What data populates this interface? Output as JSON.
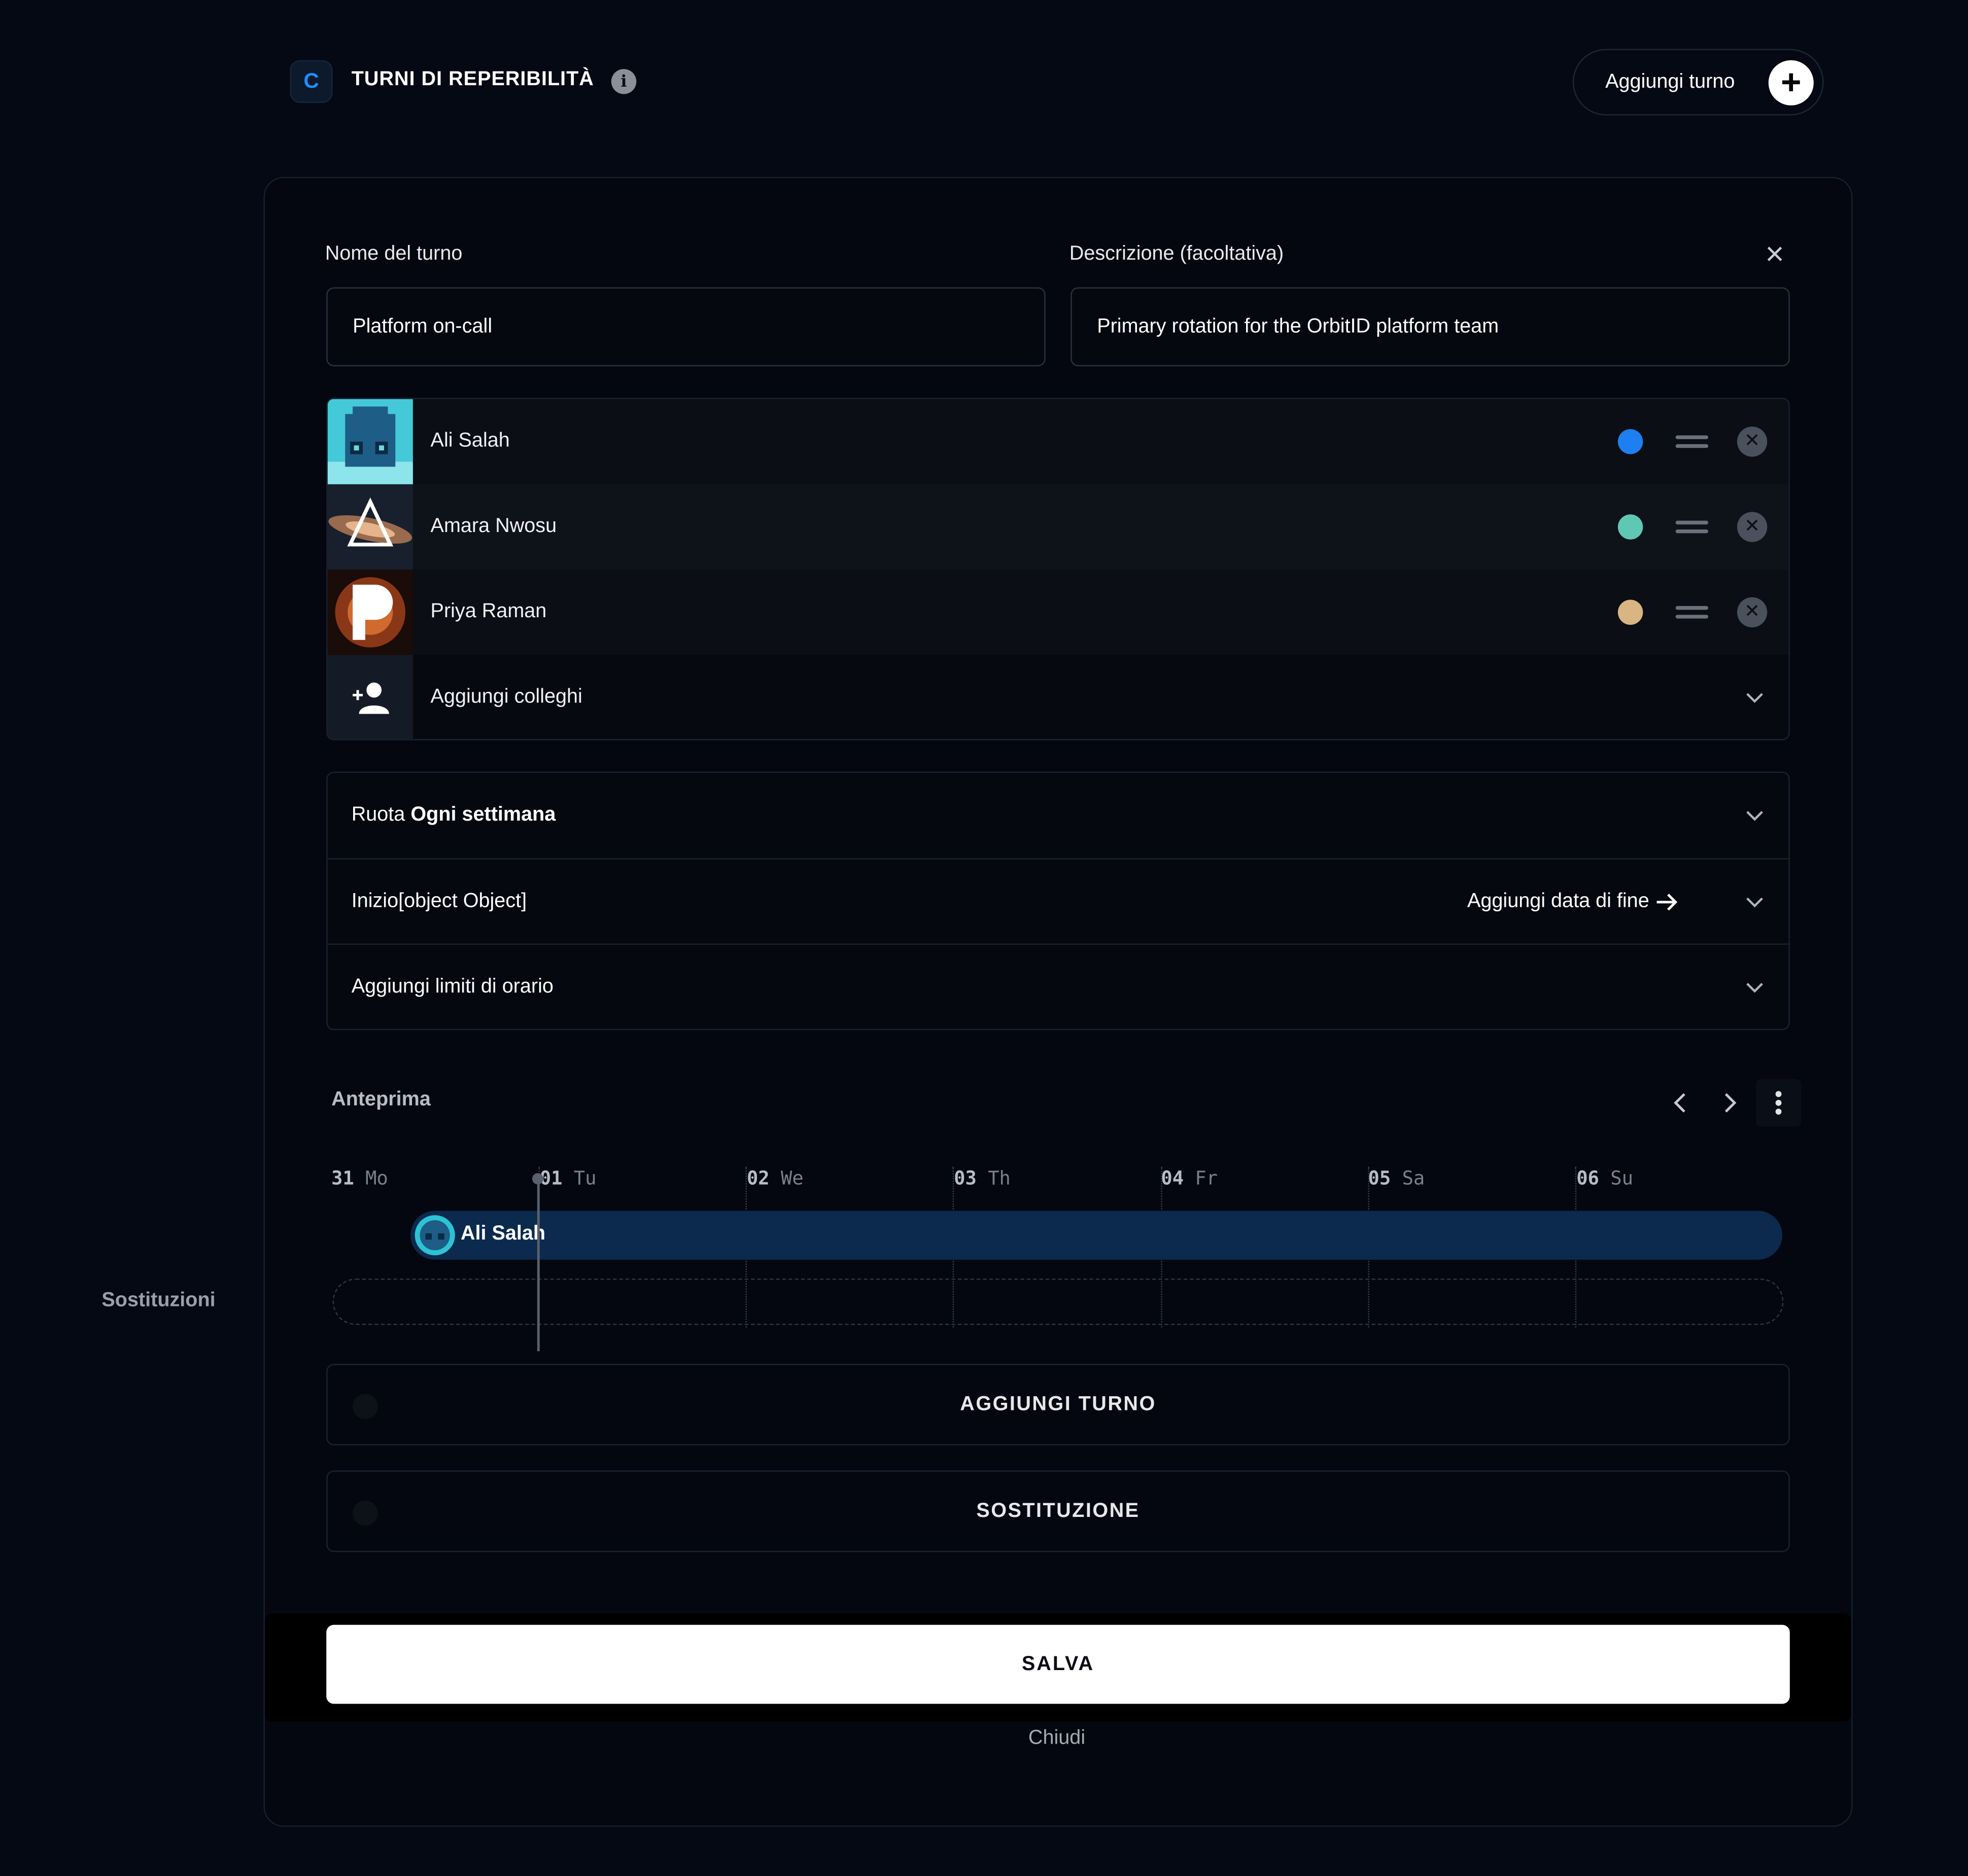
{
  "header": {
    "logo_letter": "C",
    "title": "TURNI DI REPERIBILITÀ",
    "info_glyph": "i",
    "add_button_label": "Aggiungi turno"
  },
  "form": {
    "name_label": "Nome del turno",
    "name_value": "Platform on-call",
    "description_label": "Descrizione (facoltativa)",
    "description_value": "Primary rotation for the OrbitID platform team"
  },
  "members": [
    {
      "name": "Ali Salah",
      "color": "#1e7ff0"
    },
    {
      "name": "Amara Nwosu",
      "color": "#5fc8b4"
    },
    {
      "name": "Priya Raman",
      "color": "#d8b582"
    }
  ],
  "add_colleagues_label": "Aggiungi colleghi",
  "options": {
    "rotate_prefix": "Ruota",
    "rotate_value": "Ogni settimana",
    "start_label": "Inizio[object Object]",
    "add_end_date": "Aggiungi data di fine",
    "time_limits": "Aggiungi limiti di orario"
  },
  "preview": {
    "title": "Anteprima",
    "days": [
      {
        "num": "31",
        "dow": "Mo"
      },
      {
        "num": "01",
        "dow": "Tu"
      },
      {
        "num": "02",
        "dow": "We"
      },
      {
        "num": "03",
        "dow": "Th"
      },
      {
        "num": "04",
        "dow": "Fr"
      },
      {
        "num": "05",
        "dow": "Sa"
      },
      {
        "num": "06",
        "dow": "Su"
      }
    ],
    "shift_person": "Ali Salah",
    "overrides_label": "Sostituzioni"
  },
  "buttons": {
    "add_shift": "AGGIUNGI TURNO",
    "override": "SOSTITUZIONE",
    "save": "SALVA",
    "close": "Chiudi"
  }
}
